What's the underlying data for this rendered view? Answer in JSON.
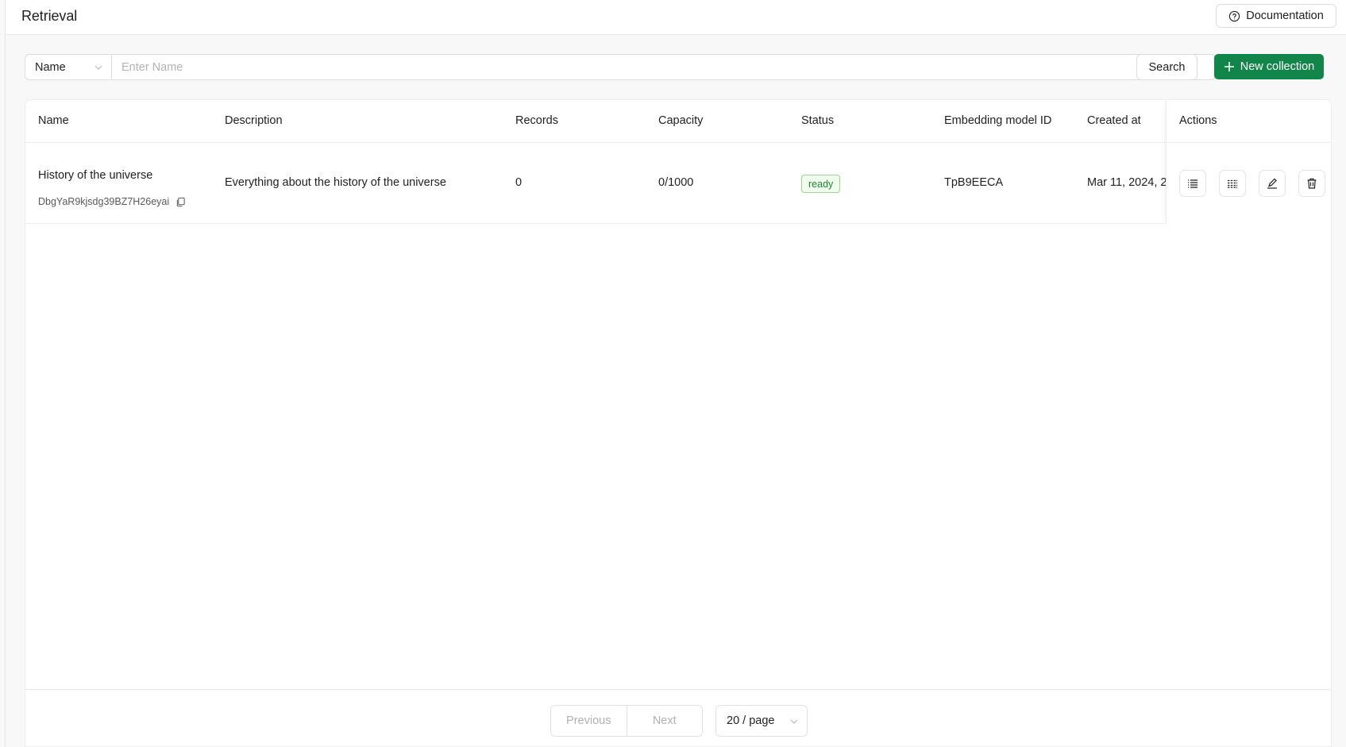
{
  "header": {
    "title": "Retrieval",
    "documentation_label": "Documentation"
  },
  "toolbar": {
    "field_select_value": "Name",
    "search_placeholder": "Enter Name",
    "search_value": "",
    "search_label": "Search",
    "new_collection_label": "New collection"
  },
  "table": {
    "columns": [
      "Name",
      "Description",
      "Records",
      "Capacity",
      "Status",
      "Embedding model ID",
      "Created at",
      "Actions"
    ],
    "rows": [
      {
        "name": "History of the universe",
        "id": "DbgYaR9kjsdg39BZ7H26eyai",
        "description": "Everything about the history of the universe",
        "records": "0",
        "capacity": "0/1000",
        "status": "ready",
        "embedding_model_id": "TpB9EECA",
        "created_at": "Mar 11, 2024, 2("
      }
    ],
    "action_icons": [
      "list-icon",
      "grid-icon",
      "edit-icon",
      "delete-icon"
    ]
  },
  "pagination": {
    "previous_label": "Previous",
    "next_label": "Next",
    "page_size_value": "20 / page"
  },
  "colors": {
    "primary": "#12854a",
    "status_ready_text": "#1b8a2c",
    "status_ready_border": "#93dd86",
    "status_ready_bg": "#f2fbf0"
  }
}
